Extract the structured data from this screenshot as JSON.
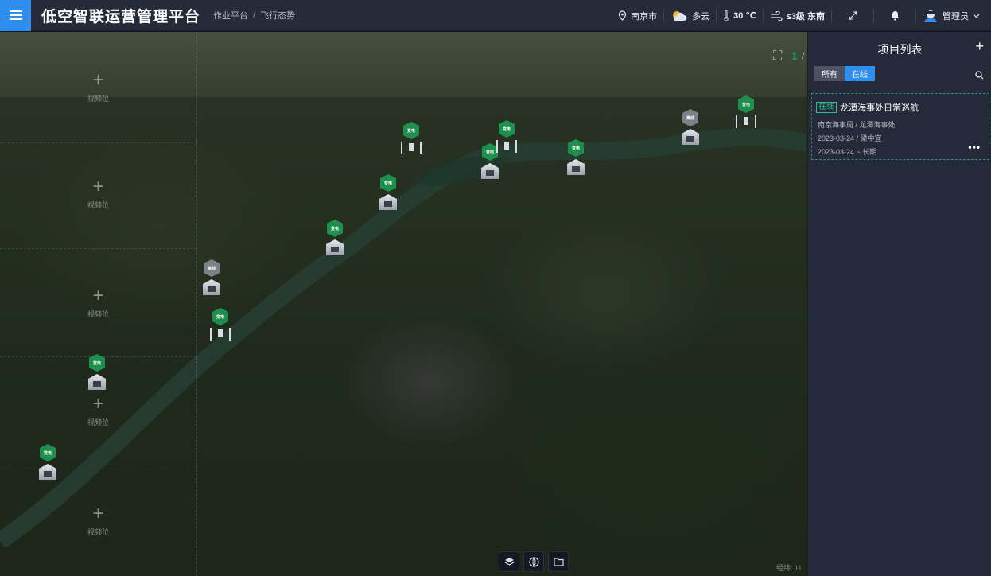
{
  "header": {
    "app_title": "低空智联运营管理平台",
    "breadcrumb": [
      "作业平台",
      "飞行态势"
    ],
    "location": "南京市",
    "weather": "多云",
    "temperature": "30 ℃",
    "wind": "≤3级 东南",
    "user": "管理员"
  },
  "map": {
    "video_slot_label": "视频位",
    "video_slots": [
      "视频位",
      "视频位",
      "视频位",
      "视频位",
      "视频位"
    ],
    "marker_tag_online": "变电",
    "marker_tag_offline": "离线",
    "fullscreen_count": "1",
    "fullscreen_sep": "/",
    "coord_label": "经纬: 11",
    "colors": {
      "online": "#1f8f4e",
      "offline": "#7d8088",
      "accent": "#2e8ef0"
    }
  },
  "bottom_tools": {
    "icons": [
      "layers-icon",
      "globe-icon",
      "folder-icon"
    ]
  },
  "panel": {
    "title": "项目列表",
    "add": "+",
    "filters": [
      "所有",
      "在线"
    ],
    "active_filter": "在线",
    "project": {
      "status": "在线",
      "name": "龙潭海事处日常巡航",
      "org": "南京海事局 / 龙潭海事处",
      "created": "2023-03-24 / 梁中宜",
      "period": "2023-03-24 ~ 长期",
      "more": "•••"
    }
  }
}
